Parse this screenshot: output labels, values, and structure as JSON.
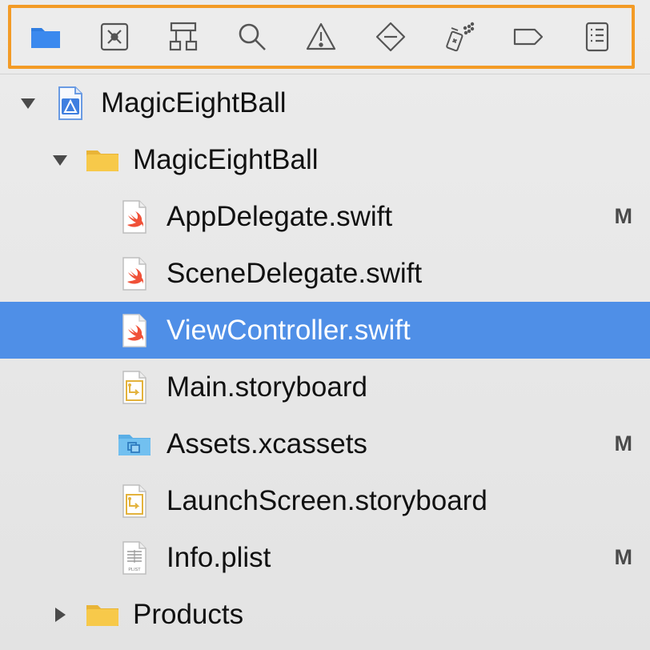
{
  "toolbar": {
    "icons": [
      {
        "name": "project-navigator-icon",
        "active": true
      },
      {
        "name": "source-control-navigator-icon"
      },
      {
        "name": "symbol-navigator-icon"
      },
      {
        "name": "find-navigator-icon"
      },
      {
        "name": "issue-navigator-icon"
      },
      {
        "name": "test-navigator-icon"
      },
      {
        "name": "debug-navigator-icon"
      },
      {
        "name": "breakpoint-navigator-icon"
      },
      {
        "name": "report-navigator-icon"
      }
    ],
    "active_color": "#2f7de1",
    "highlight_color": "#f39b26"
  },
  "tree": {
    "project": {
      "label": "MagicEightBall",
      "expanded": true
    },
    "group": {
      "label": "MagicEightBall",
      "expanded": true
    },
    "files": [
      {
        "label": "AppDelegate.swift",
        "type": "swift",
        "badge": "M"
      },
      {
        "label": "SceneDelegate.swift",
        "type": "swift",
        "badge": ""
      },
      {
        "label": "ViewController.swift",
        "type": "swift",
        "badge": "",
        "selected": true
      },
      {
        "label": "Main.storyboard",
        "type": "storyboard",
        "badge": ""
      },
      {
        "label": "Assets.xcassets",
        "type": "xcassets",
        "badge": "M"
      },
      {
        "label": "LaunchScreen.storyboard",
        "type": "storyboard",
        "badge": ""
      },
      {
        "label": "Info.plist",
        "type": "plist",
        "badge": "M",
        "icon_text": "PLIST"
      }
    ],
    "products": {
      "label": "Products",
      "expanded": false
    }
  },
  "colors": {
    "selection": "#4f8fe7",
    "folder": "#f7c94a",
    "swift": "#f05138"
  }
}
